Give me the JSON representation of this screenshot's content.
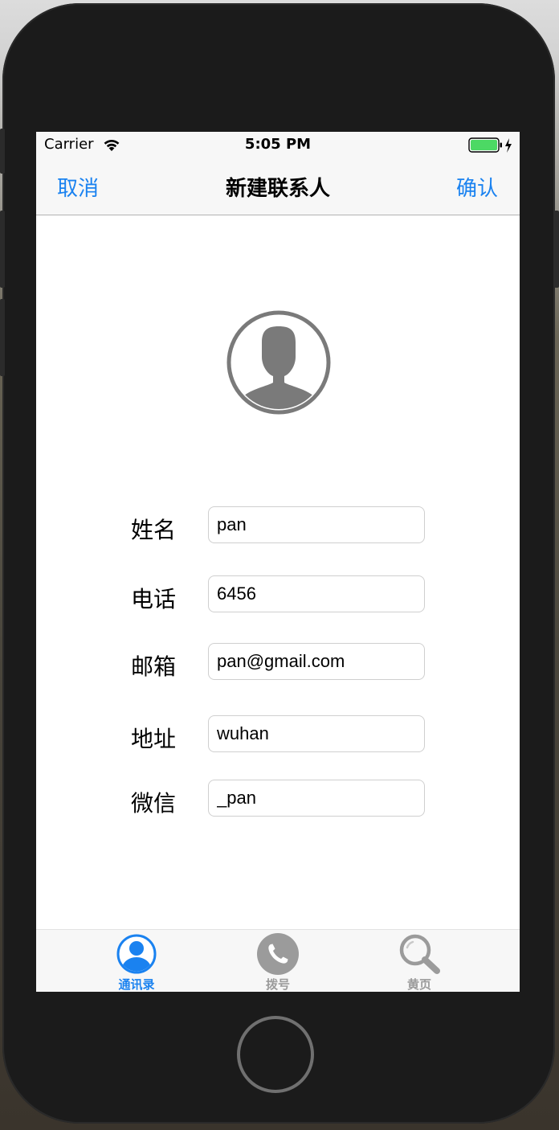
{
  "status_bar": {
    "carrier": "Carrier",
    "time": "5:05 PM",
    "battery_color": "#4cd964"
  },
  "nav": {
    "cancel_label": "取消",
    "title": "新建联系人",
    "confirm_label": "确认",
    "accent_color": "#1a82f0"
  },
  "avatar": {
    "icon": "person-placeholder-icon"
  },
  "form": {
    "name_label": "姓名",
    "name_value": "pan",
    "phone_label": "电话",
    "phone_value": "6456",
    "email_label": "邮箱",
    "email_value": "pan@gmail.com",
    "address_label": "地址",
    "address_value": "wuhan",
    "wechat_label": "微信",
    "wechat_value": "_pan"
  },
  "tabs": [
    {
      "label": "通讯录",
      "icon": "contacts-icon",
      "active": true
    },
    {
      "label": "拨号",
      "icon": "phone-icon",
      "active": false
    },
    {
      "label": "黄页",
      "icon": "search-icon",
      "active": false
    }
  ],
  "colors": {
    "tab_active": "#1a82f0",
    "tab_inactive": "#9b9b9b"
  }
}
